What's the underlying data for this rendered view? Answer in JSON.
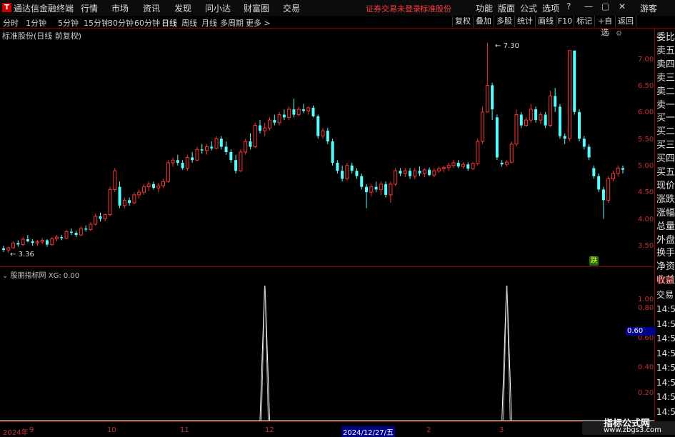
{
  "app": {
    "title": "通达信金融终端"
  },
  "menu": [
    "行情",
    "市场",
    "资讯",
    "发现",
    "问小达",
    "财富圈",
    "交易"
  ],
  "notice": {
    "trade": "证券交易未登录",
    "stock": "标准股份"
  },
  "right_menu": [
    "功能",
    "版面",
    "公式",
    "选项"
  ],
  "guest": "游客",
  "periods": [
    "分时",
    "1分钟",
    "5分钟",
    "15分钟",
    "30分钟",
    "60分钟",
    "日线",
    "周线",
    "月线",
    "多周期",
    "更多 >"
  ],
  "active_period": "日线",
  "toolbar": [
    "复权",
    "叠加",
    "多股",
    "统计",
    "画线",
    "F10",
    "标记",
    "+自选",
    "返回"
  ],
  "chart_title": "标准股份(日线 前复权)",
  "indicator_title": "股朋指标网 XG: 0.00",
  "price_ticks": [
    "7.00",
    "6.50",
    "6.00",
    "5.50",
    "5.00",
    "4.50",
    "4.00",
    "3.50"
  ],
  "ind_ticks": [
    "1.00",
    "0.80",
    "0.60",
    "0.40",
    "0.20"
  ],
  "ind_highlight": "0.60",
  "labels": {
    "high": "7.30",
    "low": "3.36",
    "fall": "跌"
  },
  "side_panel": [
    "委比",
    "卖五",
    "卖四",
    "卖三",
    "卖二",
    "卖一",
    "买一",
    "买二",
    "买三",
    "买四",
    "买五",
    "现价",
    "涨跌",
    "涨幅",
    "总量",
    "外盘",
    "换手",
    "净资",
    "收益"
  ],
  "side_lower": [
    "自动",
    "交易",
    "14:56",
    "14:56",
    "14:56",
    "14:56",
    "14:56",
    "14:56",
    "14:56",
    "14:56",
    "14:56"
  ],
  "x_labels": [
    "2024年",
    "9",
    "10",
    "11",
    "12",
    "2024/12/27/五",
    "2",
    "3"
  ],
  "watermark": {
    "line1": "指标公式网",
    "line2": "www.zbgs3.com"
  },
  "colors": {
    "up": "#ff3232",
    "down": "#54ffff",
    "axis": "#c83232",
    "divider": "#8b0000",
    "selected": "#000088"
  },
  "chart_data": [
    {
      "type": "candlestick",
      "title": "标准股份(日线 前复权)",
      "ylim": [
        3.2,
        7.6
      ],
      "ticks": [
        3.5,
        4.0,
        4.5,
        5.0,
        5.5,
        6.0,
        6.5,
        7.0
      ],
      "annotations": [
        {
          "text": "7.30",
          "value": 7.3
        },
        {
          "text": "3.36",
          "value": 3.36
        }
      ],
      "ohlc": [
        [
          3.45,
          3.5,
          3.38,
          3.42
        ],
        [
          3.42,
          3.48,
          3.36,
          3.46
        ],
        [
          3.46,
          3.58,
          3.44,
          3.55
        ],
        [
          3.55,
          3.6,
          3.48,
          3.52
        ],
        [
          3.52,
          3.66,
          3.5,
          3.62
        ],
        [
          3.62,
          3.7,
          3.56,
          3.58
        ],
        [
          3.58,
          3.62,
          3.5,
          3.55
        ],
        [
          3.55,
          3.6,
          3.5,
          3.57
        ],
        [
          3.57,
          3.64,
          3.53,
          3.6
        ],
        [
          3.6,
          3.62,
          3.48,
          3.52
        ],
        [
          3.52,
          3.66,
          3.5,
          3.63
        ],
        [
          3.63,
          3.7,
          3.58,
          3.66
        ],
        [
          3.66,
          3.7,
          3.6,
          3.64
        ],
        [
          3.64,
          3.8,
          3.62,
          3.76
        ],
        [
          3.76,
          3.82,
          3.7,
          3.74
        ],
        [
          3.74,
          3.78,
          3.66,
          3.7
        ],
        [
          3.7,
          3.86,
          3.68,
          3.82
        ],
        [
          3.82,
          3.88,
          3.76,
          3.8
        ],
        [
          3.8,
          3.94,
          3.78,
          3.9
        ],
        [
          3.9,
          4.1,
          3.88,
          4.05
        ],
        [
          4.05,
          4.12,
          3.95,
          4.0
        ],
        [
          4.0,
          4.1,
          3.96,
          4.08
        ],
        [
          4.08,
          4.6,
          4.05,
          4.55
        ],
        [
          4.55,
          4.95,
          4.5,
          4.9
        ],
        [
          4.6,
          4.7,
          4.2,
          4.25
        ],
        [
          4.25,
          4.4,
          4.2,
          4.35
        ],
        [
          4.35,
          4.4,
          4.25,
          4.3
        ],
        [
          4.3,
          4.5,
          4.28,
          4.45
        ],
        [
          4.45,
          4.55,
          4.38,
          4.5
        ],
        [
          4.5,
          4.65,
          4.45,
          4.6
        ],
        [
          4.6,
          4.7,
          4.52,
          4.65
        ],
        [
          4.65,
          4.7,
          4.55,
          4.58
        ],
        [
          4.58,
          4.68,
          4.5,
          4.62
        ],
        [
          4.62,
          4.75,
          4.58,
          4.7
        ],
        [
          4.7,
          5.1,
          4.68,
          5.05
        ],
        [
          5.05,
          5.15,
          4.98,
          5.1
        ],
        [
          5.1,
          5.2,
          5.0,
          5.05
        ],
        [
          5.05,
          5.1,
          4.92,
          4.95
        ],
        [
          4.95,
          5.2,
          4.9,
          5.15
        ],
        [
          5.15,
          5.25,
          5.05,
          5.1
        ],
        [
          5.1,
          5.35,
          5.08,
          5.3
        ],
        [
          5.3,
          5.4,
          5.22,
          5.28
        ],
        [
          5.28,
          5.4,
          5.2,
          5.35
        ],
        [
          5.35,
          5.45,
          5.28,
          5.32
        ],
        [
          5.32,
          5.55,
          5.3,
          5.5
        ],
        [
          5.5,
          5.55,
          5.3,
          5.35
        ],
        [
          5.35,
          5.45,
          5.2,
          5.25
        ],
        [
          5.25,
          5.3,
          5.05,
          5.1
        ],
        [
          5.1,
          5.2,
          4.85,
          4.9
        ],
        [
          4.9,
          5.3,
          4.88,
          5.25
        ],
        [
          5.25,
          5.5,
          5.2,
          5.45
        ],
        [
          5.45,
          5.6,
          5.3,
          5.35
        ],
        [
          5.35,
          5.8,
          5.33,
          5.75
        ],
        [
          5.75,
          5.85,
          5.6,
          5.65
        ],
        [
          5.65,
          5.8,
          5.55,
          5.7
        ],
        [
          5.7,
          5.9,
          5.65,
          5.85
        ],
        [
          5.85,
          5.95,
          5.75,
          5.8
        ],
        [
          5.8,
          6.0,
          5.75,
          5.95
        ],
        [
          5.95,
          6.05,
          5.85,
          5.9
        ],
        [
          5.9,
          6.1,
          5.85,
          6.05
        ],
        [
          6.05,
          6.25,
          5.9,
          5.95
        ],
        [
          5.95,
          6.1,
          5.92,
          6.05
        ],
        [
          6.05,
          6.15,
          5.98,
          6.02
        ],
        [
          6.02,
          6.1,
          5.95,
          6.08
        ],
        [
          6.08,
          6.12,
          5.9,
          5.92
        ],
        [
          5.92,
          5.95,
          5.5,
          5.55
        ],
        [
          5.55,
          5.7,
          5.5,
          5.65
        ],
        [
          5.65,
          5.7,
          5.4,
          5.45
        ],
        [
          5.45,
          5.5,
          5.0,
          5.05
        ],
        [
          5.05,
          5.1,
          4.85,
          4.9
        ],
        [
          4.9,
          5.0,
          4.7,
          4.75
        ],
        [
          4.75,
          5.05,
          4.72,
          5.0
        ],
        [
          5.0,
          5.05,
          4.85,
          4.9
        ],
        [
          4.9,
          4.95,
          4.75,
          4.8
        ],
        [
          4.8,
          4.85,
          4.55,
          4.6
        ],
        [
          4.6,
          4.65,
          4.2,
          4.5
        ],
        [
          4.5,
          4.65,
          4.42,
          4.6
        ],
        [
          4.6,
          4.7,
          4.5,
          4.55
        ],
        [
          4.55,
          4.7,
          4.45,
          4.65
        ],
        [
          4.65,
          4.7,
          4.4,
          4.45
        ],
        [
          4.45,
          4.7,
          4.3,
          4.65
        ],
        [
          4.65,
          4.95,
          4.62,
          4.9
        ],
        [
          4.9,
          4.95,
          4.8,
          4.85
        ],
        [
          4.85,
          4.95,
          4.78,
          4.9
        ],
        [
          4.9,
          4.95,
          4.75,
          4.8
        ],
        [
          4.8,
          4.95,
          4.75,
          4.9
        ],
        [
          4.9,
          4.98,
          4.8,
          4.85
        ],
        [
          4.85,
          4.95,
          4.78,
          4.92
        ],
        [
          4.92,
          4.96,
          4.8,
          4.82
        ],
        [
          4.82,
          4.95,
          4.78,
          4.9
        ],
        [
          4.9,
          4.98,
          4.86,
          4.94
        ],
        [
          4.94,
          5.0,
          4.88,
          4.96
        ],
        [
          4.96,
          5.05,
          4.9,
          5.0
        ],
        [
          5.0,
          5.1,
          4.95,
          5.05
        ],
        [
          5.05,
          5.1,
          4.95,
          4.98
        ],
        [
          4.98,
          5.06,
          4.94,
          5.02
        ],
        [
          5.02,
          5.06,
          4.9,
          4.94
        ],
        [
          4.94,
          5.06,
          4.92,
          5.04
        ],
        [
          5.04,
          5.5,
          5.0,
          5.45
        ],
        [
          5.45,
          6.1,
          5.4,
          6.0
        ],
        [
          6.0,
          7.3,
          6.4,
          6.5
        ],
        [
          6.5,
          6.55,
          5.85,
          6.05
        ],
        [
          5.9,
          5.95,
          5.1,
          5.15
        ],
        [
          5.05,
          5.1,
          4.98,
          5.02
        ],
        [
          5.02,
          5.1,
          4.98,
          5.06
        ],
        [
          5.06,
          5.45,
          5.04,
          5.4
        ],
        [
          5.4,
          6.05,
          5.35,
          5.95
        ],
        [
          5.95,
          6.0,
          5.7,
          5.75
        ],
        [
          5.75,
          5.9,
          5.72,
          5.85
        ],
        [
          5.85,
          6.15,
          5.8,
          6.05
        ],
        [
          6.05,
          6.1,
          5.8,
          5.85
        ],
        [
          5.85,
          6.0,
          5.78,
          5.95
        ],
        [
          5.95,
          6.0,
          5.7,
          5.75
        ],
        [
          5.75,
          6.4,
          5.72,
          6.3
        ],
        [
          6.3,
          6.45,
          6.0,
          6.1
        ],
        [
          6.1,
          6.15,
          5.5,
          5.55
        ],
        [
          5.55,
          5.6,
          5.4,
          5.5
        ],
        [
          5.5,
          7.15,
          5.45,
          7.15
        ],
        [
          7.15,
          7.1,
          5.95,
          6.0
        ],
        [
          6.0,
          6.05,
          5.45,
          5.5
        ],
        [
          5.5,
          5.55,
          5.3,
          5.35
        ],
        [
          5.35,
          5.4,
          5.1,
          5.15
        ],
        [
          4.95,
          5.0,
          4.75,
          4.8
        ],
        [
          4.8,
          4.85,
          4.5,
          4.55
        ],
        [
          4.55,
          4.6,
          4.0,
          4.35
        ],
        [
          4.35,
          4.8,
          4.3,
          4.75
        ],
        [
          4.75,
          4.9,
          4.7,
          4.85
        ],
        [
          4.85,
          5.0,
          4.8,
          4.95
        ],
        [
          4.95,
          5.0,
          4.85,
          4.92
        ]
      ]
    },
    {
      "type": "line",
      "title": "股朋指标网 XG: 0.00",
      "series": [
        {
          "values_spikes": [
            {
              "index": 54,
              "value": 1.0
            },
            {
              "index": 104,
              "value": 1.0
            }
          ]
        }
      ],
      "ylim": [
        0,
        1.1
      ],
      "ticks": [
        0.2,
        0.4,
        0.6,
        0.8,
        1.0
      ]
    }
  ]
}
